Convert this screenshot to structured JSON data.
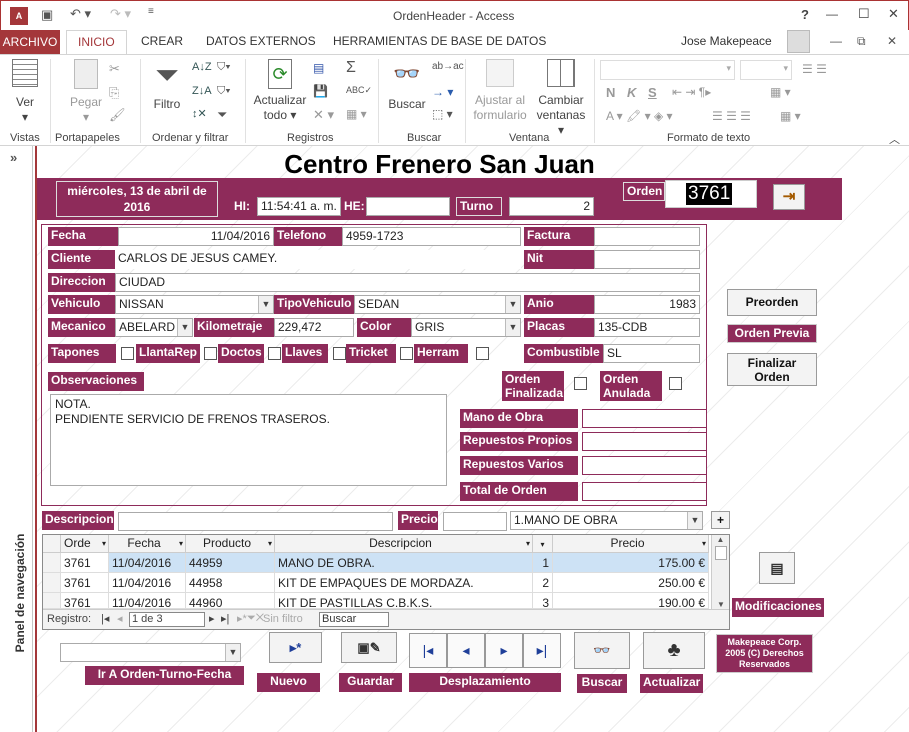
{
  "window": {
    "title": "OrdenHeader - Access",
    "help": "?",
    "minimize": "—",
    "maximize": "☐",
    "close": "✕"
  },
  "tabs": {
    "archivo": "ARCHIVO",
    "inicio": "INICIO",
    "crear": "CREAR",
    "datos_externos": "DATOS EXTERNOS",
    "herramientas": "HERRAMIENTAS DE BASE DE DATOS",
    "user": "Jose Makepeace"
  },
  "ribbon": {
    "ver": "Ver",
    "pegar": "Pegar",
    "filtro": "Filtro",
    "actualizar": "Actualizar",
    "actualizar2": "todo",
    "buscar": "Buscar",
    "ajustar": "Ajustar al",
    "ajustar2": "formulario",
    "cambiar": "Cambiar",
    "cambiar2": "ventanas",
    "groups": {
      "vistas": "Vistas",
      "portapapeles": "Portapapeles",
      "ordenar": "Ordenar y filtrar",
      "registros": "Registros",
      "buscar": "Buscar",
      "ventana": "Ventana",
      "formato": "Formato de texto"
    }
  },
  "nav": {
    "label": "Panel de navegación",
    "toggle": "»"
  },
  "form": {
    "title": "Centro Frenero San Juan",
    "date": "miércoles, 13 de abril de 2016",
    "hi_label": "HI:",
    "hi_value": "11:54:41 a. m.",
    "he_label": "HE:",
    "he_value": "",
    "turno_label": "Turno",
    "turno_value": "2",
    "orden_label": "Orden",
    "orden_value": "3761",
    "fields": {
      "fecha_label": "Fecha",
      "fecha": "11/04/2016",
      "telefono_label": "Telefono",
      "telefono": "4959-1723",
      "factura_label": "Factura",
      "factura": "",
      "cliente_label": "Cliente",
      "cliente": "CARLOS DE JESUS CAMEY.",
      "nit_label": "Nit",
      "nit": "",
      "direccion_label": "Direccion",
      "direccion": "CIUDAD",
      "vehiculo_label": "Vehiculo",
      "vehiculo": "NISSAN",
      "tipo_label": "TipoVehiculo",
      "tipo": "SEDAN",
      "anio_label": "Anio",
      "anio": "1983",
      "mecanico_label": "Mecanico",
      "mecanico": "ABELARD",
      "km_label": "Kilometraje",
      "km": "229,472",
      "color_label": "Color",
      "color": "GRIS",
      "placas_label": "Placas",
      "placas": "135-CDB",
      "tapones": "Tapones",
      "llanta": "LlantaRep",
      "doctos": "Doctos",
      "llaves": "Llaves",
      "tricket": "Tricket",
      "herram": "Herram",
      "combustible_label": "Combustible",
      "combustible": "SL",
      "obs_label": "Observaciones",
      "obs_line1": "NOTA.",
      "obs_line2": "PENDIENTE SERVICIO DE FRENOS TRASEROS.",
      "orden_fin1": "Orden",
      "orden_fin2": "Finalizada",
      "orden_anu1": "Orden",
      "orden_anu2": "Anulada",
      "mano_obra": "Mano de Obra",
      "rep_propios": "Repuestos Propios",
      "rep_varios": "Repuestos Varios",
      "total": "Total de Orden"
    },
    "side": {
      "preorden": "Preorden",
      "orden_previa": "Orden Previa",
      "finalizar1": "Finalizar",
      "finalizar2": "Orden",
      "modificaciones": "Modificaciones"
    },
    "detail": {
      "desc_label": "Descripcion",
      "precio_label": "Precio",
      "combo": "1.MANO DE OBRA",
      "plus": "+"
    },
    "grid": {
      "headers": [
        "Orde",
        "Fecha",
        "Producto",
        "Descripcion",
        "",
        "Precio"
      ],
      "rows": [
        [
          "3761",
          "11/04/2016",
          "44959",
          "MANO DE OBRA.",
          "1",
          "175.00 €"
        ],
        [
          "3761",
          "11/04/2016",
          "44958",
          "KIT DE EMPAQUES DE MORDAZA.",
          "2",
          "250.00 €"
        ],
        [
          "3761",
          "11/04/2016",
          "44960",
          "KIT DE PASTILLAS C.B.K.S.",
          "3",
          "190.00 €"
        ]
      ],
      "registro": "Registro:",
      "pos": "1 de 3",
      "sin_filtro": "Sin filtro",
      "buscar": "Buscar"
    },
    "bottom": {
      "ir": "Ir A Orden-Turno-Fecha",
      "nuevo": "Nuevo",
      "guardar": "Guardar",
      "desplazamiento": "Desplazamiento",
      "buscar": "Buscar",
      "actualizar": "Actualizar",
      "copyright": "Makepeace Corp. 2005 (C) Derechos Reservados"
    }
  }
}
